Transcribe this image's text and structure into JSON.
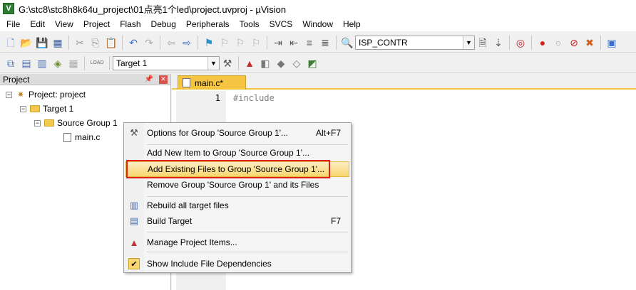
{
  "window": {
    "title": "G:\\stc8\\stc8h8k64u_project\\01点亮1个led\\project.uvproj - µVision",
    "app_icon_letter": "V"
  },
  "menubar": {
    "items": [
      "File",
      "Edit",
      "View",
      "Project",
      "Flash",
      "Debug",
      "Peripherals",
      "Tools",
      "SVCS",
      "Window",
      "Help"
    ]
  },
  "toolbar1": {
    "symbol_combo_value": "ISP_CONTR"
  },
  "toolbar2": {
    "load_label": "LOAD",
    "target_combo_value": "Target 1"
  },
  "project_panel": {
    "title": "Project",
    "tree": [
      {
        "label": "Project: project",
        "level": 0,
        "expander": "−"
      },
      {
        "label": "Target 1",
        "level": 1,
        "expander": "−"
      },
      {
        "label": "Source Group 1",
        "level": 2,
        "expander": "−"
      },
      {
        "label": "main.c",
        "level": 3
      }
    ]
  },
  "editor": {
    "tab_label": "main.c*",
    "line_number": "1",
    "code_line": "#include"
  },
  "context_menu": {
    "items": [
      {
        "label": "Options for Group 'Source Group 1'...",
        "shortcut": "Alt+F7"
      },
      {
        "label": "Add New  Item to Group 'Source Group 1'...",
        "shortcut": ""
      },
      {
        "label": "Add Existing Files to Group 'Source Group 1'...",
        "shortcut": "",
        "highlighted": true
      },
      {
        "label": "Remove Group 'Source Group 1' and its Files",
        "shortcut": ""
      },
      {
        "label": "Rebuild all target files",
        "shortcut": ""
      },
      {
        "label": "Build Target",
        "shortcut": "F7"
      },
      {
        "label": "Manage Project Items...",
        "shortcut": ""
      },
      {
        "label": "Show Include File Dependencies",
        "shortcut": "",
        "checked": true
      }
    ]
  },
  "colors": {
    "highlight": "#f8d66f",
    "annotation_box": "#e02020",
    "tab_active": "#f5c542"
  }
}
